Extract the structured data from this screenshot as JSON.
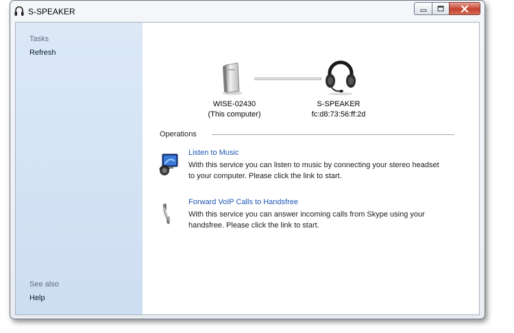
{
  "window": {
    "title": "S-SPEAKER"
  },
  "taskpane": {
    "tasks_heading": "Tasks",
    "refresh_label": "Refresh",
    "see_also_heading": "See also",
    "help_label": "Help"
  },
  "devices": {
    "computer": {
      "name": "WISE-02430",
      "subtitle": "(This computer)",
      "icon": "computer-tower-icon"
    },
    "headset": {
      "name": "S-SPEAKER",
      "address": "fc:d8:73:56:ff:2d",
      "icon": "headset-icon"
    }
  },
  "operations": {
    "heading": "Operations",
    "services": [
      {
        "link": "Listen to Music",
        "desc_line1": "With this service you can listen to music by connecting your stereo headset",
        "desc_line2": "to your computer. Please click the link to start.",
        "icon": "music-player-icon"
      },
      {
        "link": "Forward VoIP Calls to Handsfree",
        "desc_line1": "With this service you can answer incoming calls from Skype using your",
        "desc_line2": "handsfree. Please click the link to start.",
        "icon": "phone-handset-icon"
      }
    ]
  },
  "colors": {
    "link": "#1c57b3",
    "taskpane": "#d5e3f5",
    "close": "#c4432f"
  }
}
